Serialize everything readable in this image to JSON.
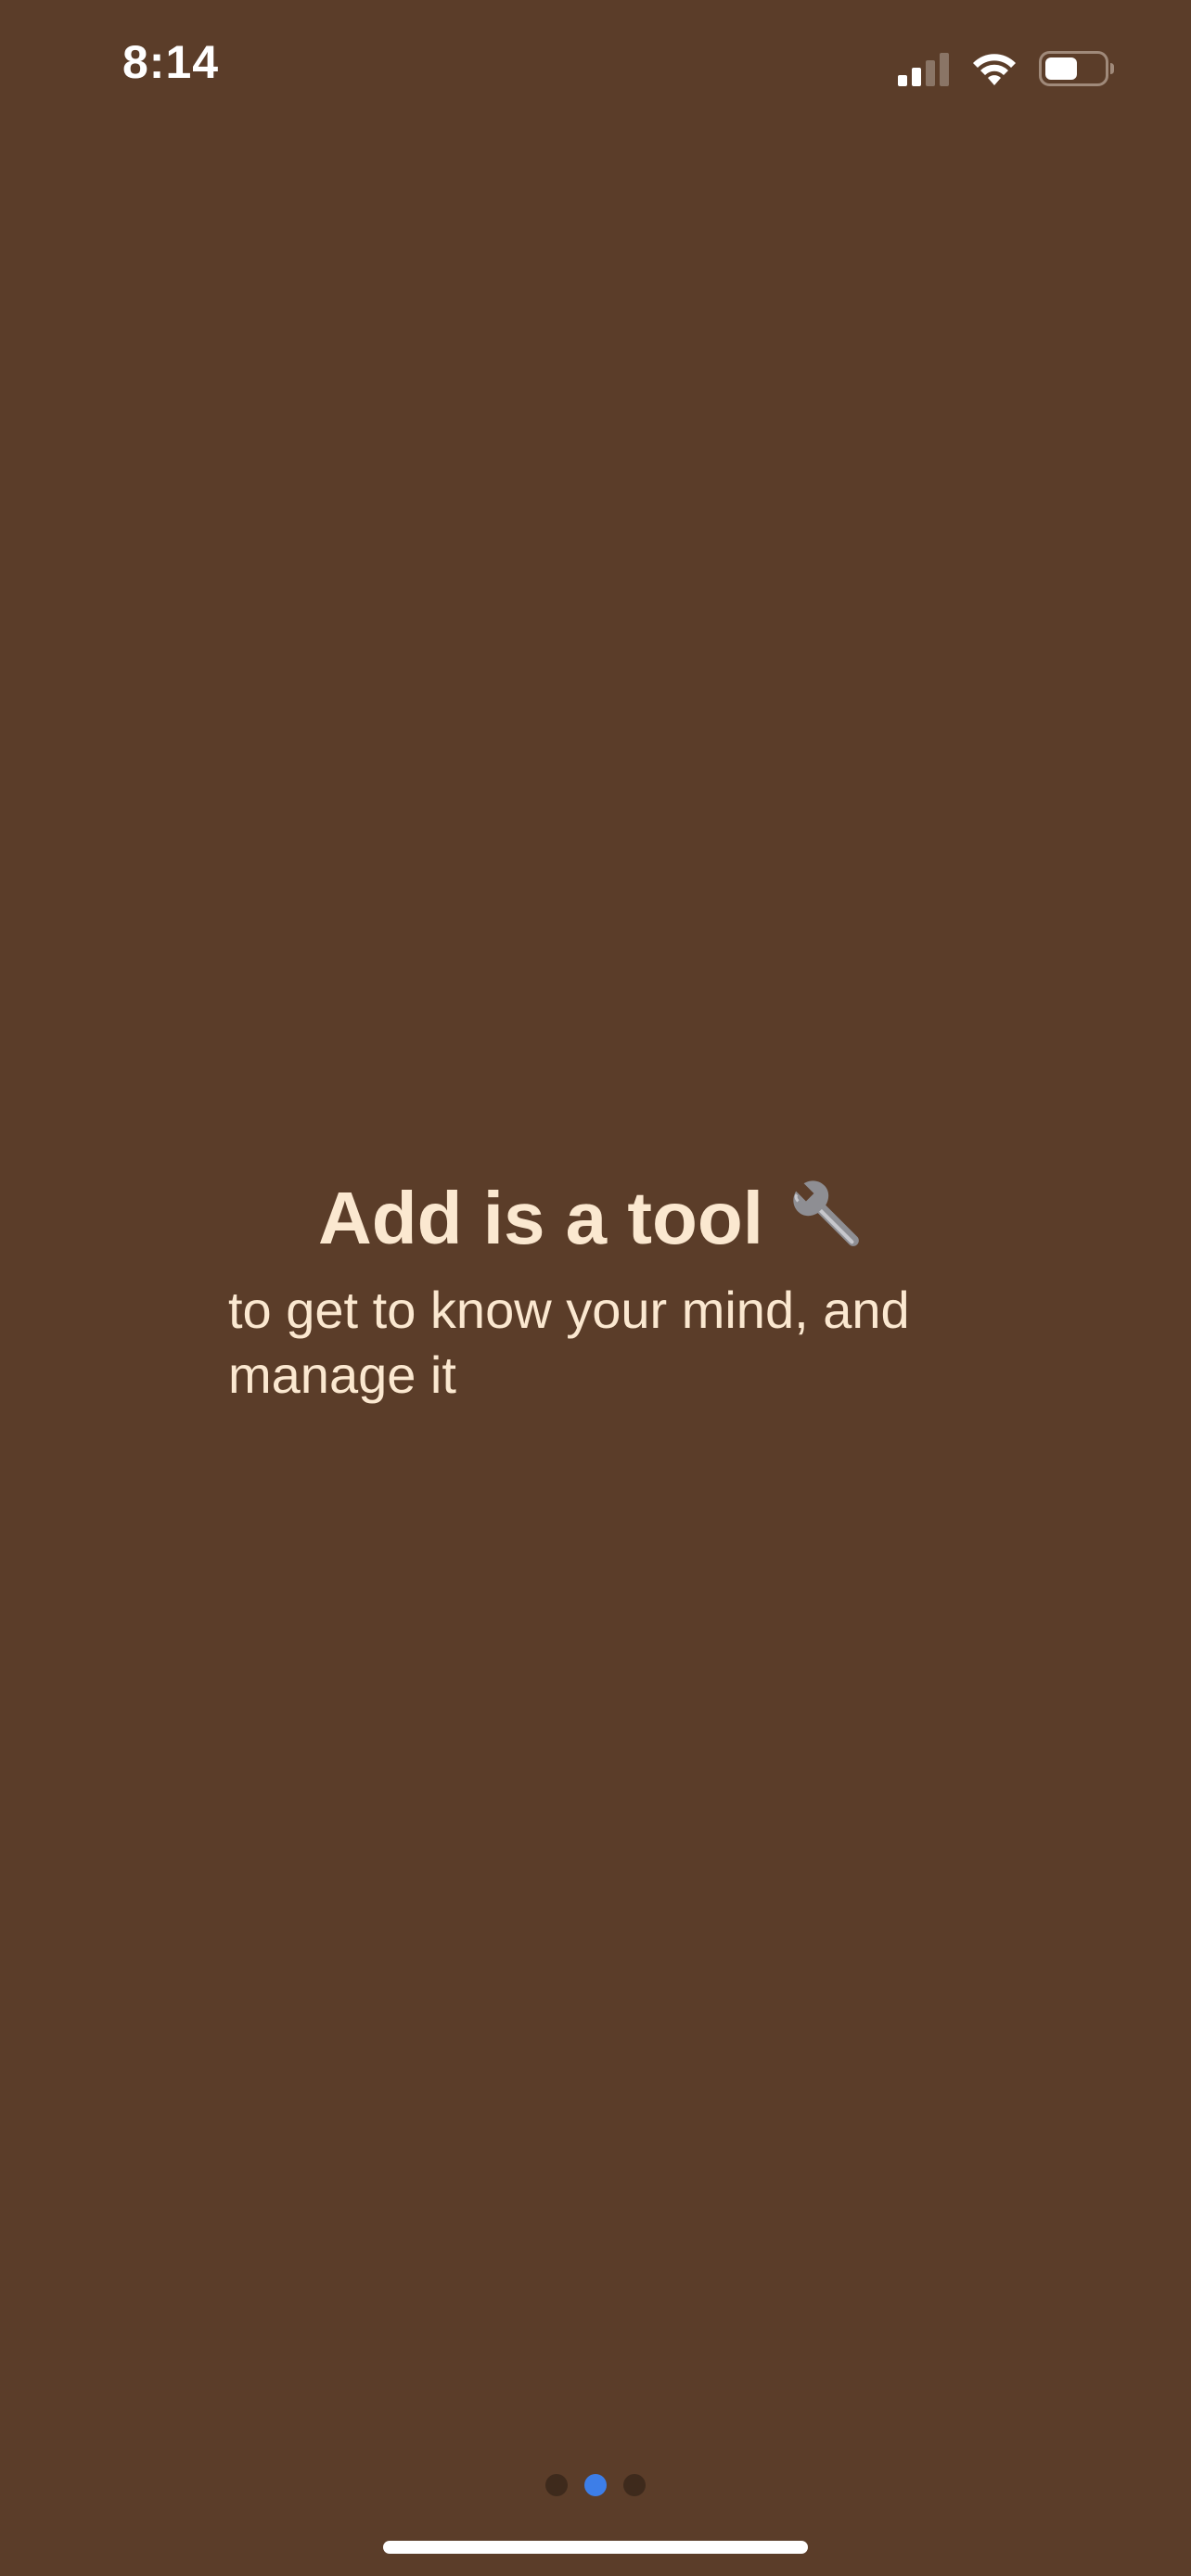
{
  "status_bar": {
    "time": "8:14",
    "icons": [
      "cellular-signal-icon",
      "wifi-icon",
      "battery-icon"
    ]
  },
  "onboarding": {
    "title": "Add is a tool",
    "title_icon": "wrench-icon",
    "subtitle": "to get to know your mind, and manage it",
    "page_indicator": {
      "total_pages": 3,
      "current_page": 2
    }
  },
  "colors": {
    "background": "#5b3d29",
    "text": "#fbe8d0",
    "active_dot": "#3d7ee8",
    "inactive_dot": "#3e2a1c"
  }
}
